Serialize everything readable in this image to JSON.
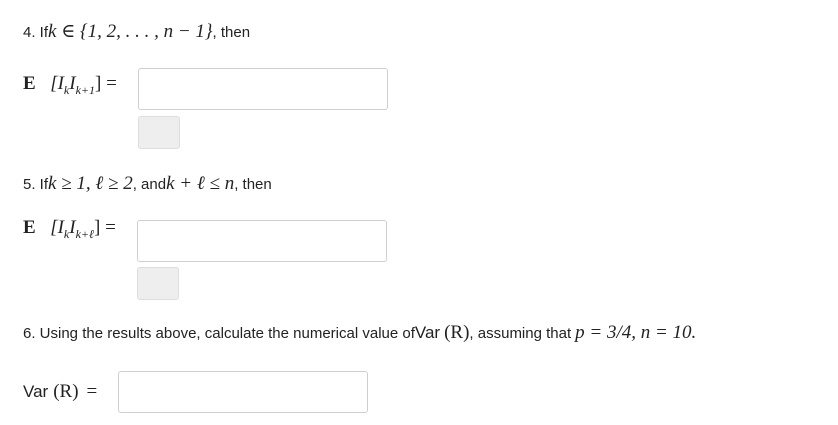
{
  "q4": {
    "number_prefix": "4. If ",
    "condition_math": "k ∈ {1, 2, . . . , n − 1}",
    "suffix": ", then",
    "lhs_E": "E",
    "lhs_args": "[I",
    "lhs_sub1": "k",
    "lhs_mid": "I",
    "lhs_sub2": "k+1",
    "lhs_close": "] =",
    "answer_value": ""
  },
  "q5": {
    "number_prefix": "5. If ",
    "condition_math_1": "k ≥ 1, ℓ ≥ 2",
    "and_text": ", and ",
    "condition_math_2": "k + ℓ ≤ n",
    "suffix": ", then",
    "lhs_E": "E",
    "lhs_args": "[I",
    "lhs_sub1": "k",
    "lhs_mid": "I",
    "lhs_sub2": "k+ℓ",
    "lhs_close": "] =",
    "answer_value": ""
  },
  "q6": {
    "text_prefix": "6. Using the results above, calculate the numerical value of ",
    "var_word": "Var",
    "var_arg": "(R)",
    "text_mid": " ,  assuming that ",
    "params_math": "p = 3/4, n = 10.",
    "lhs_var": "Var",
    "lhs_arg": "(R)",
    "lhs_eq": "=",
    "answer_value": ""
  }
}
